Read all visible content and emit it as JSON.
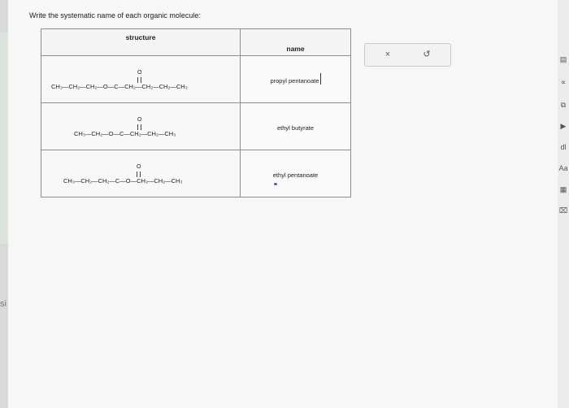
{
  "prompt": "Write the systematic name of each organic molecule:",
  "table": {
    "headers": {
      "structure": "structure",
      "name": "name"
    },
    "rows": [
      {
        "formula": "CH₃—CH₂—CH₂—O—C—CH₂—CH₂—CH₂—CH₃",
        "oxygen": "O",
        "answer": "propyl pentanoate"
      },
      {
        "formula": "CH₃—CH₂—O—C—CH₂—CH₂—CH₃",
        "oxygen": "O",
        "answer": "ethyl butyrate"
      },
      {
        "formula": "CH₃—CH₂—CH₂—C—O—CH₂—CH₂—CH₃",
        "oxygen": "O",
        "answer": "ethyl pentanoate"
      }
    ]
  },
  "tools": {
    "clear": "×",
    "undo": "↺"
  },
  "left_edge_text": "si",
  "right_tools": [
    "▤",
    "∝",
    "⧉",
    "▶",
    "dl",
    "Aa",
    "▦",
    "⌧"
  ]
}
